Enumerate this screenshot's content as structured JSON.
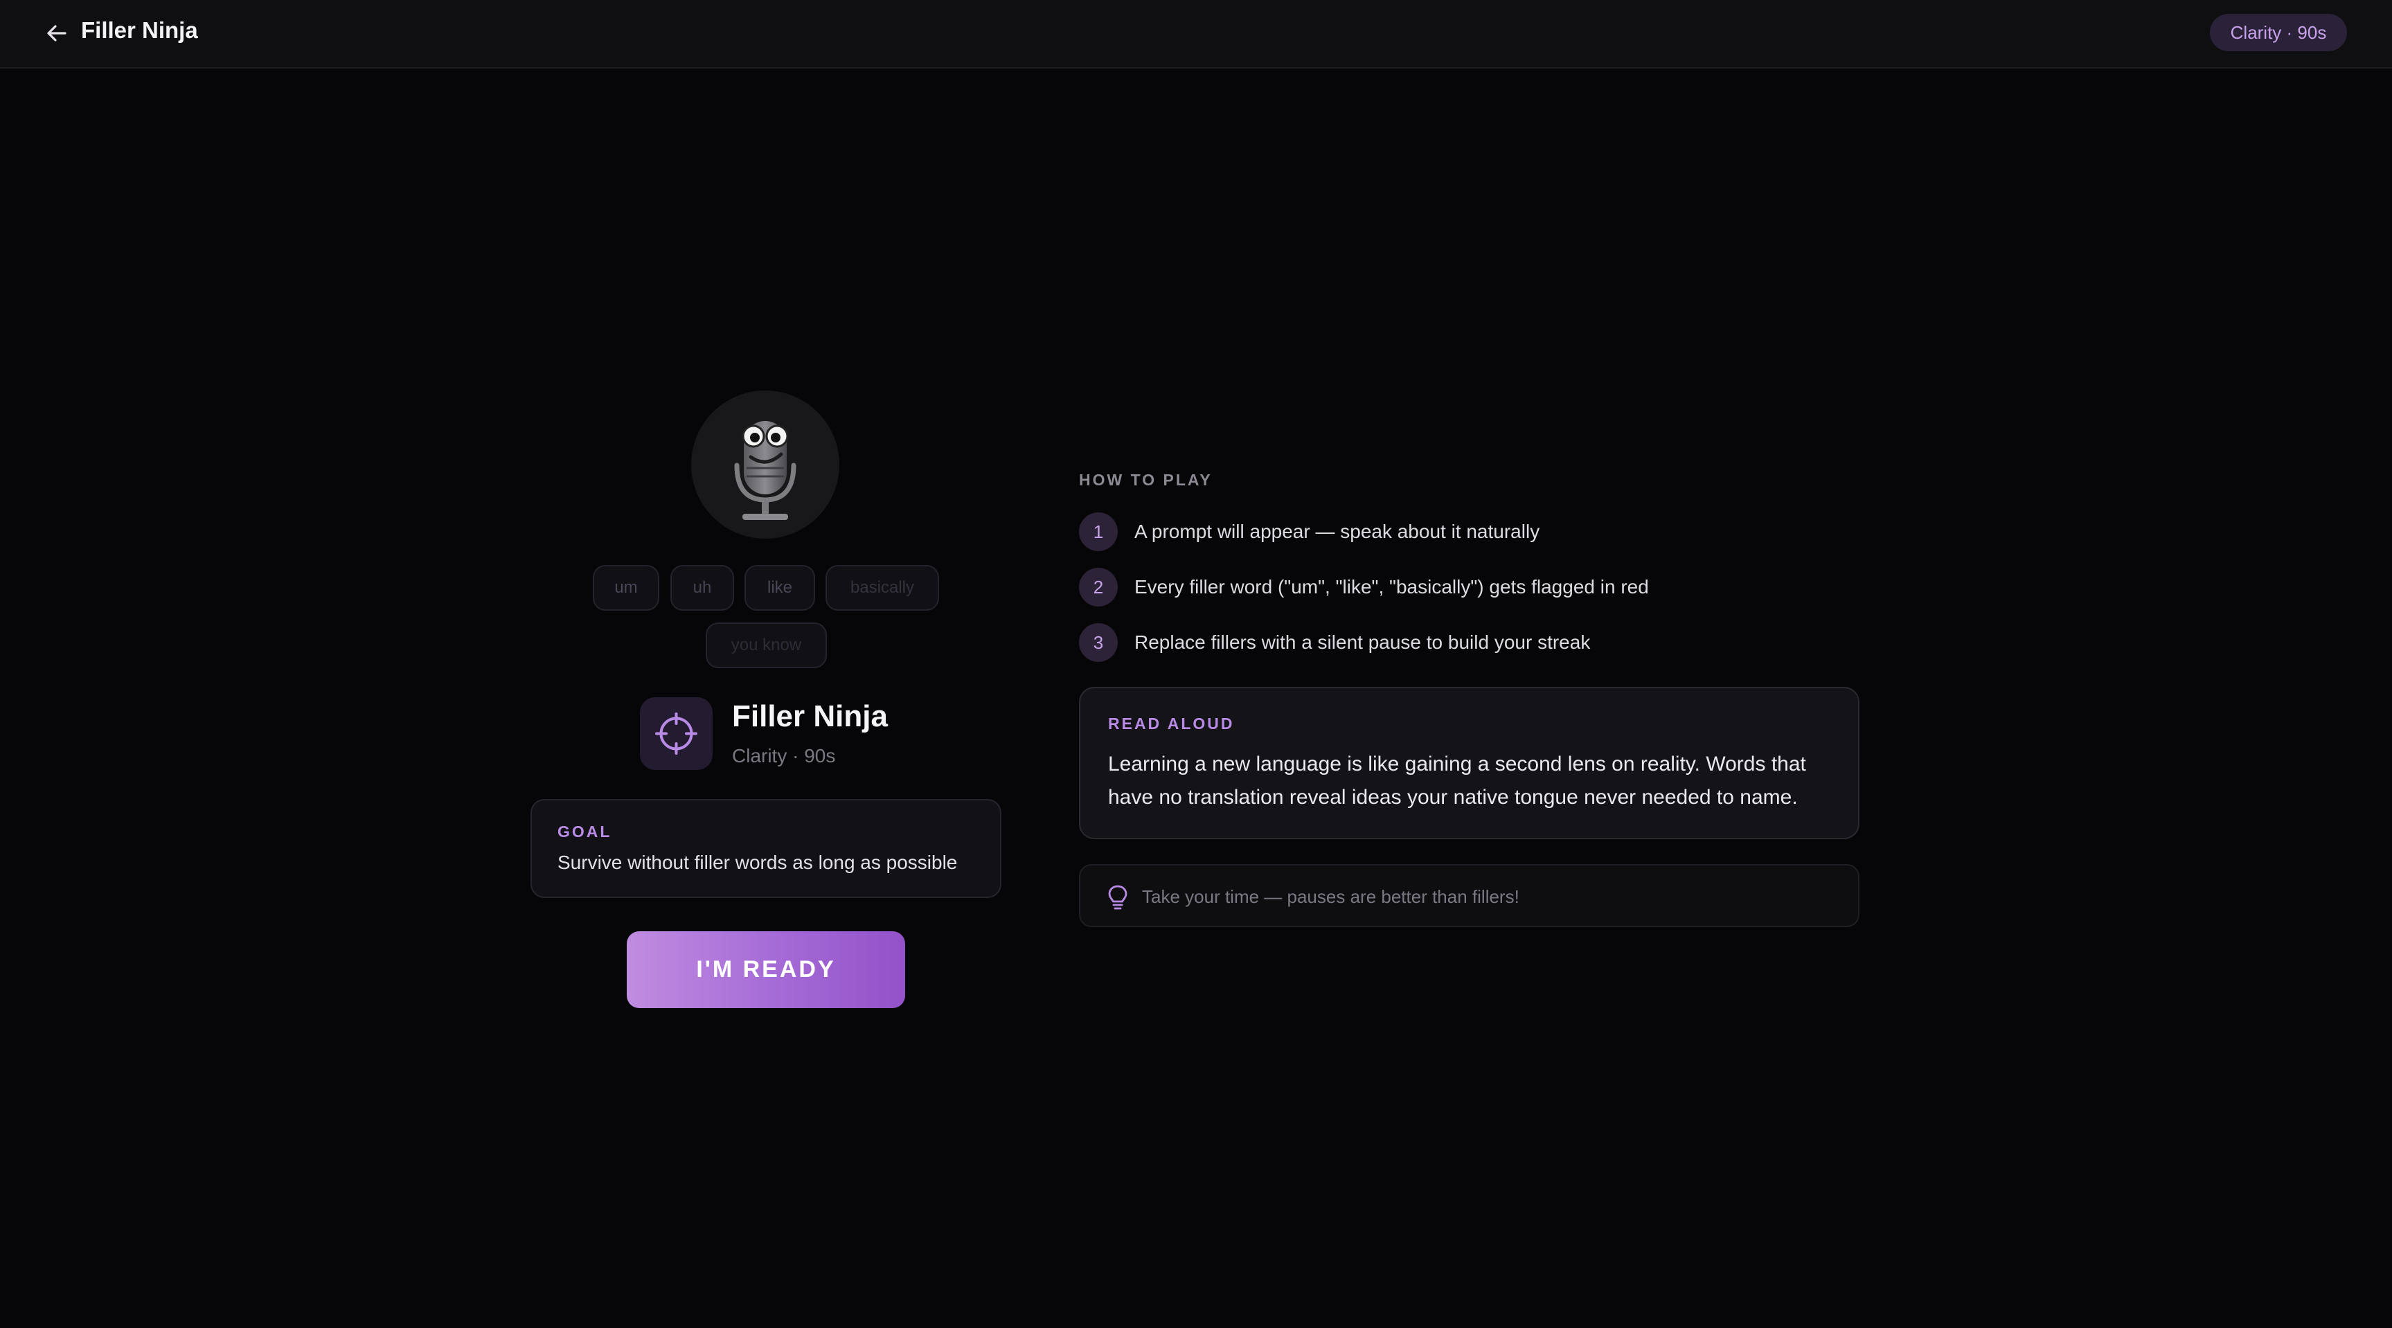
{
  "header": {
    "title": "Filler Ninja",
    "badge": "Clarity · 90s"
  },
  "left": {
    "chips": [
      "um",
      "uh",
      "like",
      "basically",
      "you know"
    ],
    "game_name": "Filler Ninja",
    "game_meta": "Clarity · 90s",
    "goal_label": "GOAL",
    "goal_text": "Survive without filler words as long as possible",
    "ready_button": "I'M READY"
  },
  "right": {
    "how_label": "HOW TO PLAY",
    "steps": [
      {
        "num": "1",
        "text": "A prompt will appear — speak about it naturally"
      },
      {
        "num": "2",
        "text": "Every filler word (\"um\", \"like\", \"basically\") gets flagged in red"
      },
      {
        "num": "3",
        "text": "Replace fillers with a silent pause to build your streak"
      }
    ],
    "read_label": "READ ALOUD",
    "read_text": "Learning a new language is like gaining a second lens on reality. Words that have no translation reveal ideas your native tongue never needed to name.",
    "tip": "Take your time — pauses are better than fillers!"
  },
  "icons": {
    "back": "arrow-left-icon",
    "mascot": "microphone-mascot-icon",
    "game": "crosshair-icon",
    "tip": "lightbulb-icon"
  },
  "colors": {
    "accent": "#b98be6",
    "background": "#060608",
    "button_gradient_start": "#c08ce0",
    "button_gradient_end": "#9352c8"
  }
}
